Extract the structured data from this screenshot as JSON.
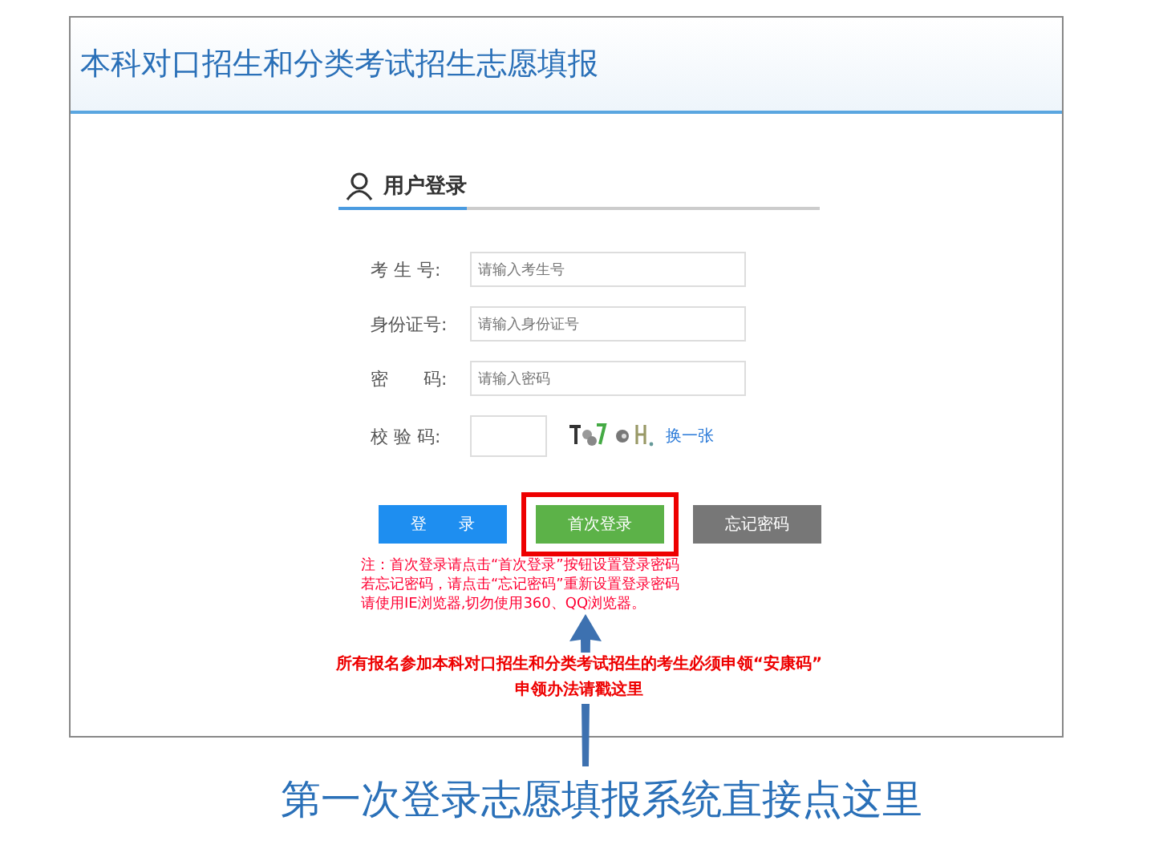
{
  "window": {
    "title": "本科对口招生和分类考试招生志愿填报"
  },
  "login": {
    "heading": "用户登录",
    "fields": [
      {
        "label": "考 生 号:",
        "placeholder": "请输入考生号",
        "kind": "text"
      },
      {
        "label": "身份证号:",
        "placeholder": "请输入身份证号",
        "kind": "text"
      },
      {
        "label": "密　　码:",
        "placeholder": "请输入密码",
        "kind": "text"
      },
      {
        "label": "校 验 码:",
        "kind": "captcha",
        "refresh": "换一张"
      }
    ],
    "buttons": [
      {
        "label": "登　　录",
        "kind": "primary",
        "highlighted": false
      },
      {
        "label": "首次登录",
        "kind": "success",
        "highlighted": true
      },
      {
        "label": "忘记密码",
        "kind": "secondary",
        "highlighted": false
      }
    ],
    "notes": [
      "注：首次登录请点击“首次登录”按钮设置登录密码",
      "若忘记密码，请点击“忘记密码”重新设置登录密码",
      "请使用IE浏览器,切勿使用360、QQ浏览器。"
    ],
    "notice": [
      "所有报名参加本科对口招生和分类考试招生的考生必须申领“安康码”",
      "申领办法请戳这里"
    ]
  },
  "caption": "第一次登录志愿填报系统直接点这里"
}
